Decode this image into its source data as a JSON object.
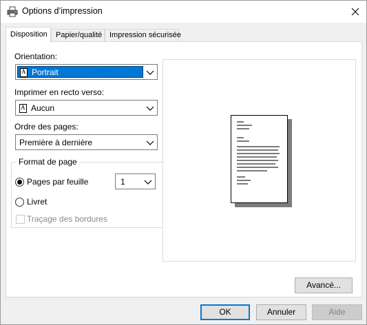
{
  "window": {
    "title": "Options d’impression",
    "title_icon": "printer-icon",
    "close_icon": "close-icon"
  },
  "tabs": [
    {
      "label": "Disposition",
      "active": true
    },
    {
      "label": "Papier/qualité",
      "active": false
    },
    {
      "label": "Impression sécurisée",
      "active": false
    }
  ],
  "orientation": {
    "label": "Orientation:",
    "value": "Portrait"
  },
  "duplex": {
    "label": "Imprimer en recto verso:",
    "value": "Aucun"
  },
  "page_order": {
    "label": "Ordre des pages:",
    "value": "Première à dernière"
  },
  "page_format": {
    "title": "Format de page",
    "pages_per_sheet_label": "Pages par feuille",
    "pages_per_sheet_value": "1",
    "booklet_label": "Livret",
    "borders_label": "Traçage des bordures",
    "selected": "pages_per_sheet"
  },
  "buttons": {
    "advanced": "Avancé...",
    "ok": "OK",
    "cancel": "Annuler",
    "help": "Aide"
  },
  "colors": {
    "accent": "#0078d7",
    "window_bg": "#f0f0f0"
  }
}
